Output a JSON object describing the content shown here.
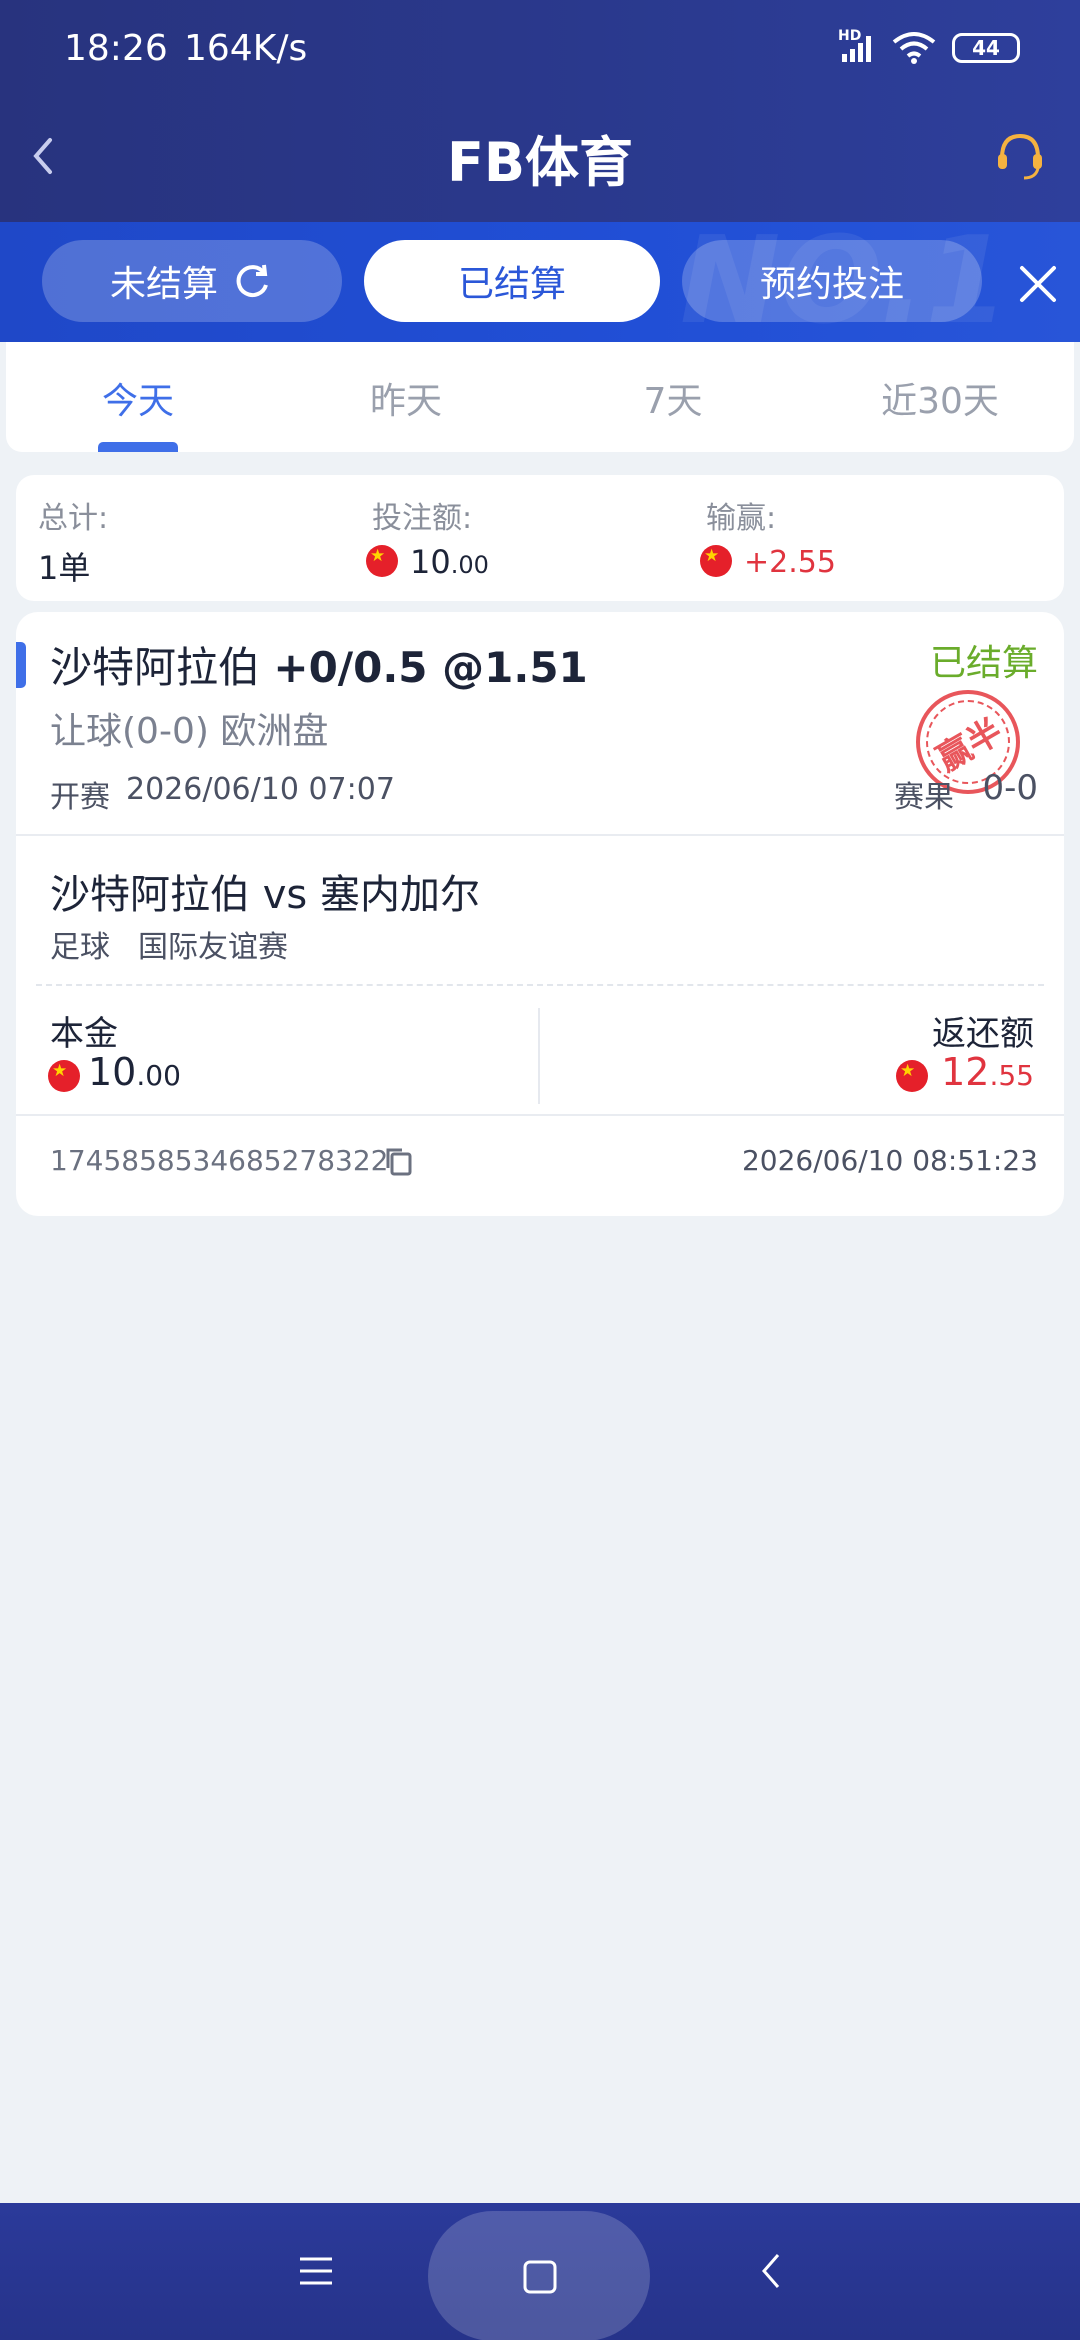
{
  "status_bar": {
    "time": "18:26",
    "speed": "164K/s",
    "network": "HD",
    "battery": "44"
  },
  "header": {
    "title": "FB体育",
    "back_icon": "chevron-left-icon",
    "service_icon": "headset-icon"
  },
  "tabs": [
    {
      "label": "未结算"
    },
    {
      "label": "已结算"
    },
    {
      "label": "预约投注"
    }
  ],
  "day_tabs": [
    {
      "label": "今天"
    },
    {
      "label": "昨天"
    },
    {
      "label": "7天"
    },
    {
      "label": "近30天"
    }
  ],
  "summary": {
    "total_label": "总计:",
    "total_value": "1单",
    "stake_label": "投注额:",
    "stake_int": "10",
    "stake_dec": ".00",
    "win_label": "输赢:",
    "win_value": "+2.55"
  },
  "bet": {
    "team": "沙特阿拉伯",
    "selection": "+0/0.5 @1.51",
    "status": "已结算",
    "market": "让球(0-0) 欧洲盘",
    "start_label": "开赛",
    "start_time": "2026/06/10 07:07",
    "result_label": "赛果",
    "result_value": "0-0",
    "stamp": "赢半",
    "match": "沙特阿拉伯 vs 塞内加尔",
    "sport": "足球",
    "league": "国际友谊赛",
    "principal_label": "本金",
    "principal_int": "10",
    "principal_dec": ".00",
    "return_label": "返还额",
    "return_int": "12",
    "return_dec": ".55",
    "order_id": "1745858534685278322",
    "settle_time": "2026/06/10 08:51:23"
  },
  "colors": {
    "accent": "#3f6fe8",
    "win": "#e0343f",
    "settled": "#6aac2b",
    "header": "#2a398d"
  }
}
